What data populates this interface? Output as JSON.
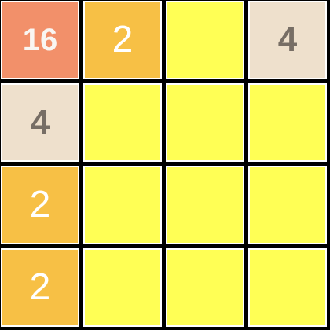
{
  "board": {
    "rows": [
      [
        {
          "value": "16",
          "bg": "#f2906a",
          "fg": "#f9f6f2"
        },
        {
          "value": "2",
          "bg": "#f7c045",
          "fg": "#ffffff"
        },
        {
          "value": "",
          "bg": "#ffff55",
          "fg": "#776e65"
        },
        {
          "value": "4",
          "bg": "#eee0cc",
          "fg": "#776e65"
        }
      ],
      [
        {
          "value": "4",
          "bg": "#eee0cc",
          "fg": "#776e65"
        },
        {
          "value": "",
          "bg": "#ffff55",
          "fg": "#776e65"
        },
        {
          "value": "",
          "bg": "#ffff55",
          "fg": "#776e65"
        },
        {
          "value": "",
          "bg": "#ffff55",
          "fg": "#776e65"
        }
      ],
      [
        {
          "value": "2",
          "bg": "#f7c045",
          "fg": "#ffffff"
        },
        {
          "value": "",
          "bg": "#ffff55",
          "fg": "#776e65"
        },
        {
          "value": "",
          "bg": "#ffff55",
          "fg": "#776e65"
        },
        {
          "value": "",
          "bg": "#ffff55",
          "fg": "#776e65"
        }
      ],
      [
        {
          "value": "2",
          "bg": "#f7c045",
          "fg": "#ffffff"
        },
        {
          "value": "",
          "bg": "#ffff55",
          "fg": "#776e65"
        },
        {
          "value": "",
          "bg": "#ffff55",
          "fg": "#776e65"
        },
        {
          "value": "",
          "bg": "#ffff55",
          "fg": "#776e65"
        }
      ]
    ]
  },
  "colors": {
    "grid_line": "#000000",
    "cell_border": "#ffffff",
    "empty_cell": "#ffff55",
    "tile_2": "#f7c045",
    "tile_4": "#eee0cc",
    "tile_16": "#f2906a"
  }
}
